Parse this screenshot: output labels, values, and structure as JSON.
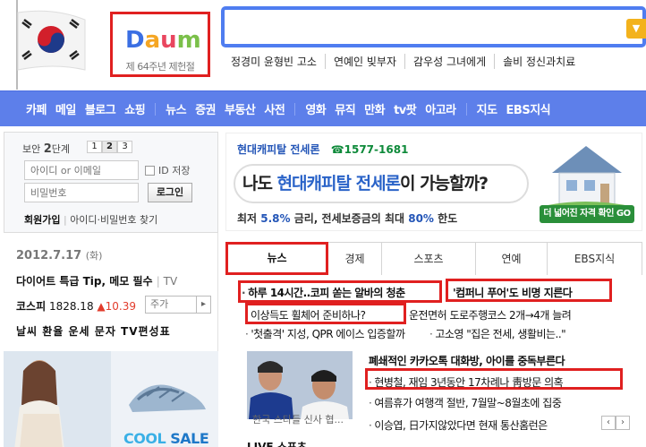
{
  "header": {
    "logo_text": "Daum",
    "logo_subtitle": "제 64주년 제헌절",
    "search_placeholder": "",
    "search_button_icon": "chevron-down-icon",
    "realtime_keywords": [
      "정경미 윤형빈 고소",
      "연예인 빚부자",
      "감우성 그녀에게",
      "솔비 정신과치료"
    ]
  },
  "nav": {
    "group1": [
      "카페",
      "메일",
      "블로그",
      "쇼핑"
    ],
    "group2": [
      "뉴스",
      "증권",
      "부동산",
      "사전"
    ],
    "group3": [
      "영화",
      "뮤직",
      "만화",
      "tv팟",
      "아고라"
    ],
    "group4": [
      "지도",
      "EBS지식"
    ]
  },
  "login": {
    "security_label": "보안",
    "security_level": "2",
    "security_suffix": "단계",
    "steps": [
      "1",
      "2",
      "3"
    ],
    "id_placeholder": "아이디 or 이메일",
    "pw_placeholder": "비밀번호",
    "id_save_label": "ID 저장",
    "login_button": "로그인",
    "signup": "회원가입",
    "find_links": "아이디·비밀번호 찾기"
  },
  "left_info": {
    "date": "2012.7.17",
    "day": "(화)",
    "promo": "다이어트 특급 Tip, 메모 필수",
    "promo_tag": "TV",
    "kospi_label": "코스피",
    "kospi_value": "1828.18",
    "kospi_change": "▲10.39",
    "stock_placeholder": "주가",
    "quick_links": "날씨 환율 운세 문자 TV편성표",
    "ad_text": "COOL",
    "ad_text2": "SALE"
  },
  "banner": {
    "brand": "현대캐피탈 전세론",
    "phone": "☎1577-1681",
    "headline_pre": "나도 ",
    "headline_em": "현대캐피탈 전세론",
    "headline_post": "이 가능할까?",
    "desc_pre": "최저 ",
    "desc_rate": "5.8%",
    "desc_mid": " 금리, 전세보증금의 최대 ",
    "desc_max": "80%",
    "desc_post": " 한도",
    "go_button": "더 넓어진 자격 확인 GO"
  },
  "tabs": [
    "뉴스",
    "경제",
    "스포츠",
    "연예",
    "EBS지식"
  ],
  "news": {
    "h1": "하루 14시간..코피 쏟는 알바의 청춘",
    "h2": "'컴퍼니 푸어'도 비명 지른다",
    "h3": "이상득도 휠체어 준비하나?",
    "h4": "운전면허 도로주행코스 2개→4개 늘려",
    "h5": "'첫출격' 지성, QPR 에이스 입증할까",
    "h6": "고소영 \"집은 전세, 생활비는..\"",
    "h7": "폐쇄적인 카카오톡 대화방, 아이를 중독부른다",
    "h8": "현병철, 재임 3년동안 17차례나 靑방문 의혹",
    "h9": "여름휴가 여행객 절반, 7월말~8월초에 집중",
    "h10": "이승엽, 日가지않았다면 현재 통산홈런은",
    "photo_caption": "한국 스타들 신사 협...",
    "more_title": "LIVE 스포츠",
    "pager_prev": "‹",
    "pager_next": "›"
  },
  "colors": {
    "accent_red": "#e02020",
    "nav_blue": "#5d7fea",
    "search_border": "#4f7df0",
    "kospi_up": "#e23c2c"
  }
}
